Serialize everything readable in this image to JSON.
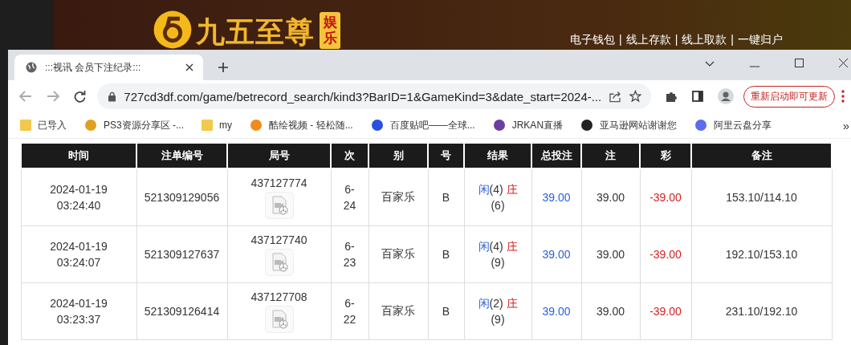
{
  "background_site": {
    "logo_text": "九五至尊",
    "logo_badge": "娱乐",
    "nav": [
      "电子钱包",
      "|",
      "线上存款",
      "|",
      "线上取款",
      "|",
      "一键归户"
    ]
  },
  "browser": {
    "tabs": [
      {
        "title": ":::视讯 会员下注纪录:::",
        "selected": true
      }
    ],
    "address": "727cd3df.com/game/betrecord_search/kind3?BarID=1&GameKind=3&date_start=2024-...",
    "update_button": "重新启动即可更新",
    "bookmarks": [
      {
        "label": "已导入",
        "kind": "folder"
      },
      {
        "label": "PS3资源分享区 -...",
        "kind": "ps3"
      },
      {
        "label": "my",
        "kind": "folder"
      },
      {
        "label": "酷绘视频 - 轻松随...",
        "kind": "kuhui"
      },
      {
        "label": "百度贴吧——全球...",
        "kind": "baidu"
      },
      {
        "label": "JRKAN直播",
        "kind": "jrkan"
      },
      {
        "label": "亚马逊网站谢谢您",
        "kind": "amazon"
      },
      {
        "label": "阿里云盘分享",
        "kind": "aliyun"
      }
    ],
    "bookmarks_overflow": "»"
  },
  "table": {
    "columns": [
      "时间",
      "注单编号",
      "局号",
      "次",
      "别",
      "号",
      "结果",
      "总投注",
      "注",
      "彩",
      "备注"
    ],
    "rows": [
      {
        "time": "2024-01-19 03:24:40",
        "bet_no": "521309129056",
        "round_no": "437127774",
        "shoe": "6-24",
        "game": "百家乐",
        "table": "B",
        "result": {
          "player_label": "闲",
          "player_points": "(4)",
          "banker_label": "庄",
          "banker_points": "(6)"
        },
        "total_bet": "39.00",
        "valid_bet": "39.00",
        "payout": "-39.00",
        "note": "153.10/114.10"
      },
      {
        "time": "2024-01-19 03:24:07",
        "bet_no": "521309127637",
        "round_no": "437127740",
        "shoe": "6-23",
        "game": "百家乐",
        "table": "B",
        "result": {
          "player_label": "闲",
          "player_points": "(4)",
          "banker_label": "庄",
          "banker_points": "(9)"
        },
        "total_bet": "39.00",
        "valid_bet": "39.00",
        "payout": "-39.00",
        "note": "192.10/153.10"
      },
      {
        "time": "2024-01-19 03:23:37",
        "bet_no": "521309126414",
        "round_no": "437127708",
        "shoe": "6-22",
        "game": "百家乐",
        "table": "B",
        "result": {
          "player_label": "闲",
          "player_points": "(2)",
          "banker_label": "庄",
          "banker_points": "(9)"
        },
        "total_bet": "39.00",
        "valid_bet": "39.00",
        "payout": "-39.00",
        "note": "231.10/192.10"
      }
    ]
  }
}
